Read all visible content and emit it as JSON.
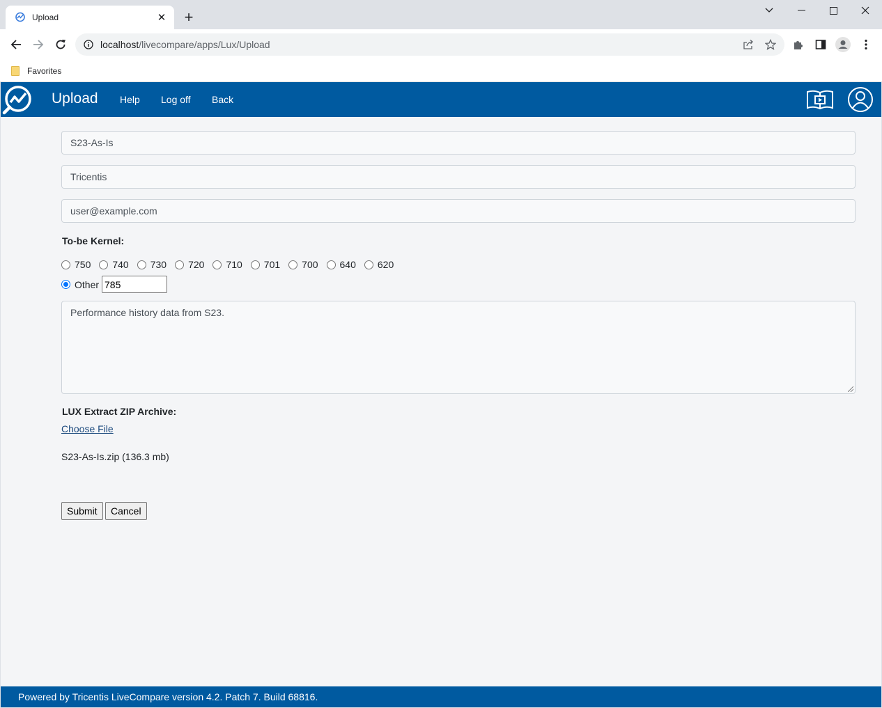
{
  "browser": {
    "tab_title": "Upload",
    "url_host": "localhost",
    "url_path": "/livecompare/apps/Lux/Upload",
    "bookmark_folder": "Favorites"
  },
  "appbar": {
    "title": "Upload",
    "links": [
      "Help",
      "Log off",
      "Back"
    ],
    "brand_color": "#005aa0"
  },
  "form": {
    "system_name": "S23-As-Is",
    "company": "Tricentis",
    "email": "user@example.com",
    "kernel_label": "To-be Kernel:",
    "kernel_options": [
      "750",
      "740",
      "730",
      "720",
      "710",
      "701",
      "700",
      "640",
      "620"
    ],
    "other_label": "Other",
    "other_value": "785",
    "selected_kernel": "Other",
    "description": "Performance history data from S23.",
    "archive_label": "LUX Extract ZIP Archive:",
    "choose_file_label": "Choose File",
    "file_info": "S23-As-Is.zip (136.3 mb)",
    "submit_label": "Submit",
    "cancel_label": "Cancel"
  },
  "footer": {
    "text": "Powered by Tricentis LiveCompare version 4.2. Patch 7. Build 68816."
  },
  "icons": {
    "tab_favicon": "livecompare-logo-icon",
    "tab_close": "close-icon",
    "new_tab": "plus-icon",
    "back": "arrow-left-icon",
    "forward": "arrow-right-icon",
    "reload": "reload-icon",
    "site_info": "info-icon",
    "share": "share-icon",
    "bookmark_star": "star-icon",
    "extensions": "puzzle-icon",
    "side_panel": "side-panel-icon",
    "profile": "profile-icon",
    "menu": "kebab-menu-icon",
    "app_logo": "livecompare-logo-icon",
    "help_book": "book-video-icon",
    "user": "user-icon"
  }
}
